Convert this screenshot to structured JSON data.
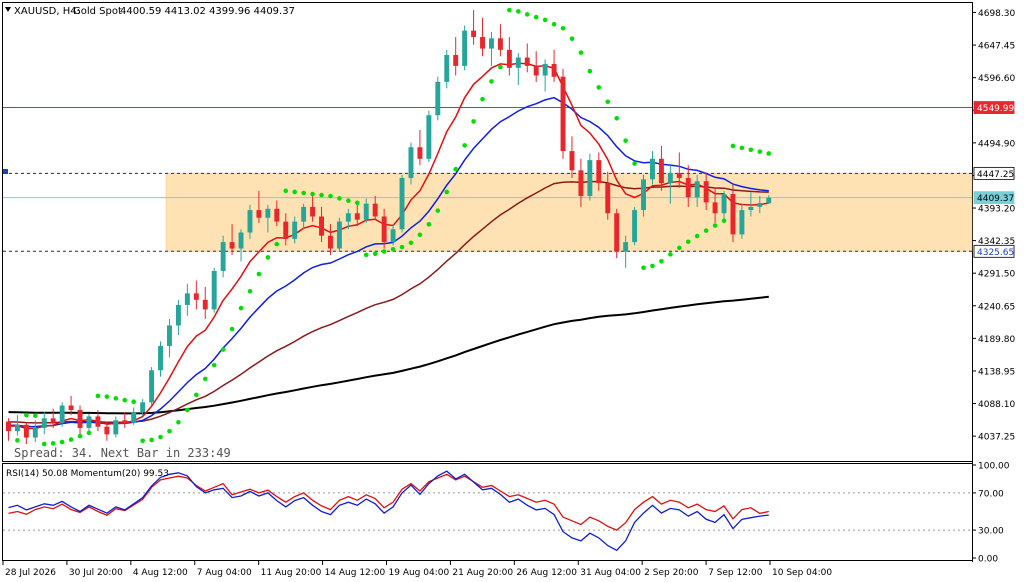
{
  "header": {
    "symbol": "XAUUSD, H4:",
    "description": "Gold Spot",
    "ohlc": "4400.59 4413.02 4399.96 4409.37"
  },
  "status_text": "Spread: 34. Next Bar in 233:49",
  "indicator_label": "RSI(14) 50.08 Momentum(20) 99.53",
  "price_axis": {
    "min": 4000,
    "max": 4710,
    "ticks": [
      "4698.30",
      "4647.45",
      "4596.60",
      "4545.75",
      "4494.90",
      "4444.05",
      "4393.20",
      "4342.35",
      "4291.50",
      "4240.65",
      "4189.80",
      "4138.95",
      "4088.10",
      "4037.25"
    ]
  },
  "price_tags": [
    {
      "value": 4549.99,
      "label": "4549.99",
      "bg": "#e8262b",
      "fg": "#ffffff"
    },
    {
      "value": 4447.25,
      "label": "4447.25",
      "bg": "#ffffff",
      "fg": "#000000"
    },
    {
      "value": 4409.37,
      "label": "4409.37",
      "bg": "#7ad0d8",
      "fg": "#000000"
    },
    {
      "value": 4325.65,
      "label": "4325.65",
      "bg": "#ffffff",
      "fg": "#1a3fbf"
    }
  ],
  "indicator_axis": {
    "min": 0,
    "max": 100,
    "ticks": [
      "100.00",
      "70.00",
      "30.00",
      "0.00"
    ]
  },
  "time_axis": [
    "28 Jul 2026",
    "30 Jul 20:00",
    "4 Aug 12:00",
    "7 Aug 04:00",
    "11 Aug 20:00",
    "14 Aug 12:00",
    "19 Aug 04:00",
    "21 Aug 20:00",
    "26 Aug 12:00",
    "31 Aug 04:00",
    "2 Sep 20:00",
    "7 Sep 12:00",
    "10 Sep 04:00"
  ],
  "zone": {
    "top": 4447.25,
    "bottom": 4325.65,
    "color": "#ffe2b3"
  },
  "colors": {
    "bull": "#26a69a",
    "bear": "#e8262b",
    "ma_fast": "#e01010",
    "ma_mid": "#1020e0",
    "ma_slow": "#8b1a1a",
    "ma_long": "#000000",
    "sar": "#00e000",
    "rsi": "#e01010",
    "momentum": "#1020d0",
    "resistance": "#e8262b",
    "current": "#7ad0d8"
  },
  "chart_data": {
    "type": "candlestick",
    "series": [
      {
        "name": "XAUUSD",
        "values": [
          [
            4060,
            4065,
            4030,
            4045
          ],
          [
            4045,
            4070,
            4038,
            4055
          ],
          [
            4055,
            4058,
            4025,
            4035
          ],
          [
            4035,
            4062,
            4028,
            4050
          ],
          [
            4050,
            4075,
            4040,
            4065
          ],
          [
            4065,
            4080,
            4050,
            4058
          ],
          [
            4058,
            4090,
            4052,
            4085
          ],
          [
            4085,
            4100,
            4070,
            4078
          ],
          [
            4078,
            4085,
            4040,
            4050
          ],
          [
            4050,
            4072,
            4045,
            4068
          ],
          [
            4068,
            4078,
            4045,
            4052
          ],
          [
            4052,
            4060,
            4030,
            4040
          ],
          [
            4040,
            4068,
            4035,
            4062
          ],
          [
            4062,
            4075,
            4050,
            4058
          ],
          [
            4058,
            4082,
            4055,
            4075
          ],
          [
            4075,
            4095,
            4068,
            4090
          ],
          [
            4090,
            4145,
            4085,
            4140
          ],
          [
            4140,
            4185,
            4130,
            4178
          ],
          [
            4178,
            4220,
            4160,
            4210
          ],
          [
            4210,
            4250,
            4195,
            4242
          ],
          [
            4242,
            4275,
            4225,
            4260
          ],
          [
            4260,
            4280,
            4235,
            4250
          ],
          [
            4250,
            4270,
            4220,
            4235
          ],
          [
            4235,
            4300,
            4230,
            4295
          ],
          [
            4295,
            4350,
            4285,
            4340
          ],
          [
            4340,
            4368,
            4320,
            4330
          ],
          [
            4330,
            4360,
            4310,
            4355
          ],
          [
            4355,
            4398,
            4345,
            4390
          ],
          [
            4390,
            4420,
            4370,
            4378
          ],
          [
            4378,
            4398,
            4355,
            4392
          ],
          [
            4392,
            4405,
            4365,
            4372
          ],
          [
            4372,
            4385,
            4335,
            4345
          ],
          [
            4345,
            4380,
            4338,
            4372
          ],
          [
            4372,
            4400,
            4360,
            4395
          ],
          [
            4395,
            4415,
            4372,
            4380
          ],
          [
            4380,
            4395,
            4340,
            4350
          ],
          [
            4350,
            4368,
            4320,
            4330
          ],
          [
            4330,
            4378,
            4325,
            4372
          ],
          [
            4372,
            4392,
            4360,
            4385
          ],
          [
            4385,
            4398,
            4365,
            4375
          ],
          [
            4375,
            4408,
            4370,
            4400
          ],
          [
            4400,
            4412,
            4375,
            4380
          ],
          [
            4380,
            4392,
            4330,
            4340
          ],
          [
            4340,
            4368,
            4335,
            4360
          ],
          [
            4360,
            4445,
            4355,
            4440
          ],
          [
            4440,
            4495,
            4430,
            4488
          ],
          [
            4488,
            4515,
            4460,
            4470
          ],
          [
            4470,
            4545,
            4465,
            4538
          ],
          [
            4538,
            4598,
            4530,
            4590
          ],
          [
            4590,
            4640,
            4580,
            4632
          ],
          [
            4632,
            4660,
            4600,
            4615
          ],
          [
            4615,
            4678,
            4608,
            4670
          ],
          [
            4670,
            4702,
            4648,
            4660
          ],
          [
            4660,
            4690,
            4630,
            4642
          ],
          [
            4642,
            4668,
            4615,
            4658
          ],
          [
            4658,
            4680,
            4630,
            4640
          ],
          [
            4640,
            4660,
            4600,
            4612
          ],
          [
            4612,
            4635,
            4585,
            4628
          ],
          [
            4628,
            4650,
            4605,
            4615
          ],
          [
            4615,
            4638,
            4590,
            4600
          ],
          [
            4600,
            4625,
            4575,
            4618
          ],
          [
            4618,
            4640,
            4590,
            4598
          ],
          [
            4598,
            4610,
            4470,
            4482
          ],
          [
            4482,
            4505,
            4440,
            4452
          ],
          [
            4452,
            4470,
            4395,
            4412
          ],
          [
            4412,
            4478,
            4405,
            4468
          ],
          [
            4468,
            4480,
            4420,
            4432
          ],
          [
            4432,
            4450,
            4375,
            4385
          ],
          [
            4385,
            4392,
            4315,
            4325
          ],
          [
            4325,
            4350,
            4300,
            4340
          ],
          [
            4340,
            4395,
            4335,
            4390
          ],
          [
            4390,
            4445,
            4380,
            4438
          ],
          [
            4438,
            4482,
            4430,
            4470
          ],
          [
            4470,
            4490,
            4420,
            4432
          ],
          [
            4432,
            4460,
            4400,
            4448
          ],
          [
            4448,
            4480,
            4425,
            4440
          ],
          [
            4440,
            4460,
            4395,
            4410
          ],
          [
            4410,
            4445,
            4395,
            4435
          ],
          [
            4435,
            4448,
            4390,
            4402
          ],
          [
            4402,
            4425,
            4370,
            4385
          ],
          [
            4385,
            4420,
            4375,
            4415
          ],
          [
            4415,
            4430,
            4340,
            4352
          ],
          [
            4352,
            4400,
            4345,
            4390
          ],
          [
            4390,
            4418,
            4380,
            4395
          ],
          [
            4395,
            4412,
            4385,
            4401
          ],
          [
            4400.59,
            4413.02,
            4399.96,
            4409.37
          ]
        ]
      }
    ],
    "rsi": [
      48,
      50,
      47,
      52,
      55,
      53,
      58,
      52,
      49,
      55,
      50,
      46,
      53,
      51,
      57,
      63,
      76,
      84,
      86,
      88,
      86,
      78,
      72,
      76,
      80,
      68,
      71,
      74,
      70,
      73,
      66,
      60,
      66,
      70,
      62,
      56,
      52,
      62,
      66,
      62,
      68,
      64,
      54,
      60,
      74,
      80,
      72,
      82,
      86,
      90,
      84,
      88,
      82,
      76,
      78,
      72,
      66,
      68,
      64,
      60,
      62,
      58,
      44,
      40,
      36,
      44,
      40,
      34,
      30,
      38,
      52,
      60,
      66,
      58,
      62,
      60,
      54,
      58,
      52,
      50,
      56,
      42,
      52,
      54,
      48,
      50
    ],
    "momentum": [
      100.5,
      100.8,
      100.2,
      100.6,
      101.0,
      100.8,
      101.3,
      100.6,
      100.0,
      100.8,
      100.3,
      99.8,
      100.6,
      100.2,
      101.0,
      101.8,
      103.3,
      104.4,
      104.8,
      105.0,
      104.6,
      103.2,
      102.4,
      102.8,
      103.0,
      101.8,
      102.0,
      102.6,
      102.0,
      102.4,
      101.4,
      100.6,
      101.4,
      101.8,
      100.8,
      100.0,
      99.6,
      100.8,
      101.2,
      100.8,
      101.6,
      101.0,
      99.8,
      100.6,
      102.4,
      103.4,
      102.2,
      103.6,
      104.6,
      105.2,
      104.2,
      104.8,
      103.8,
      102.8,
      103.0,
      102.2,
      101.2,
      101.6,
      100.8,
      100.2,
      100.4,
      99.6,
      97.4,
      96.6,
      96.2,
      97.2,
      96.6,
      95.6,
      95.0,
      96.2,
      98.6,
      99.8,
      100.8,
      99.8,
      100.4,
      100.2,
      99.4,
      100.0,
      99.0,
      98.6,
      99.6,
      97.8,
      99.0,
      99.2,
      99.4,
      99.53
    ],
    "momentum_range": [
      94,
      106
    ],
    "xlim_bars": 108,
    "ylim": [
      4000,
      4710
    ],
    "grid": false
  }
}
